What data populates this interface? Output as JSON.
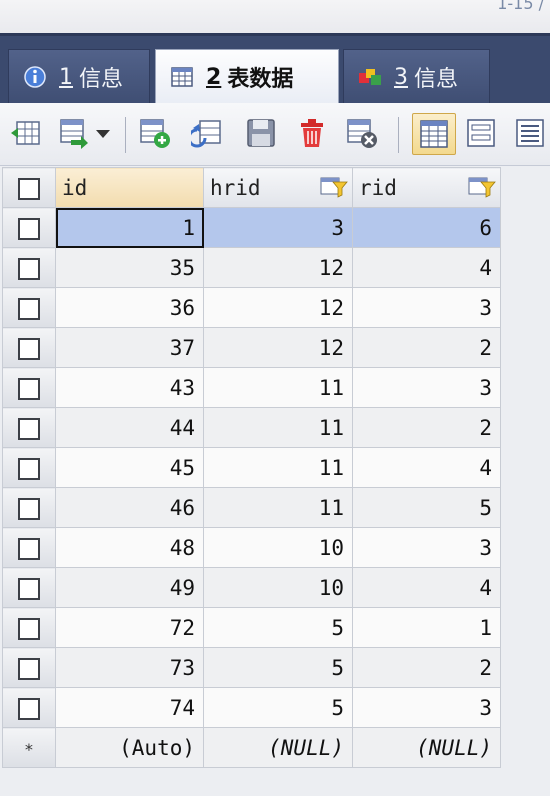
{
  "topstrip": {
    "fragment": "1-15 /"
  },
  "tabs": [
    {
      "num": "1",
      "label": "信息",
      "active": false
    },
    {
      "num": "2",
      "label": "表数据",
      "active": true
    },
    {
      "num": "3",
      "label": "信息",
      "active": false
    }
  ],
  "toolbar": {
    "icons": [
      "insert-row-icon",
      "view-format-icon",
      "dropdown-arrow-icon",
      "add-row-icon",
      "refresh-icon",
      "save-icon",
      "delete-icon",
      "cancel-icon",
      "grid-view-icon",
      "form-view-icon",
      "text-view-icon"
    ]
  },
  "grid": {
    "columns": [
      "id",
      "hrid",
      "rid"
    ],
    "rows": [
      [
        "1",
        "3",
        "6"
      ],
      [
        "35",
        "12",
        "4"
      ],
      [
        "36",
        "12",
        "3"
      ],
      [
        "37",
        "12",
        "2"
      ],
      [
        "43",
        "11",
        "3"
      ],
      [
        "44",
        "11",
        "2"
      ],
      [
        "45",
        "11",
        "4"
      ],
      [
        "46",
        "11",
        "5"
      ],
      [
        "48",
        "10",
        "3"
      ],
      [
        "49",
        "10",
        "4"
      ],
      [
        "72",
        "5",
        "1"
      ],
      [
        "73",
        "5",
        "2"
      ],
      [
        "74",
        "5",
        "3"
      ]
    ],
    "new_row_marker": "*",
    "new_row": [
      "(Auto)",
      "(NULL)",
      "(NULL)"
    ]
  },
  "colors": {
    "tabbar": "#3b4a6e",
    "selected_row": "#b4c7ec",
    "toggled_button": "#f3d98e"
  }
}
